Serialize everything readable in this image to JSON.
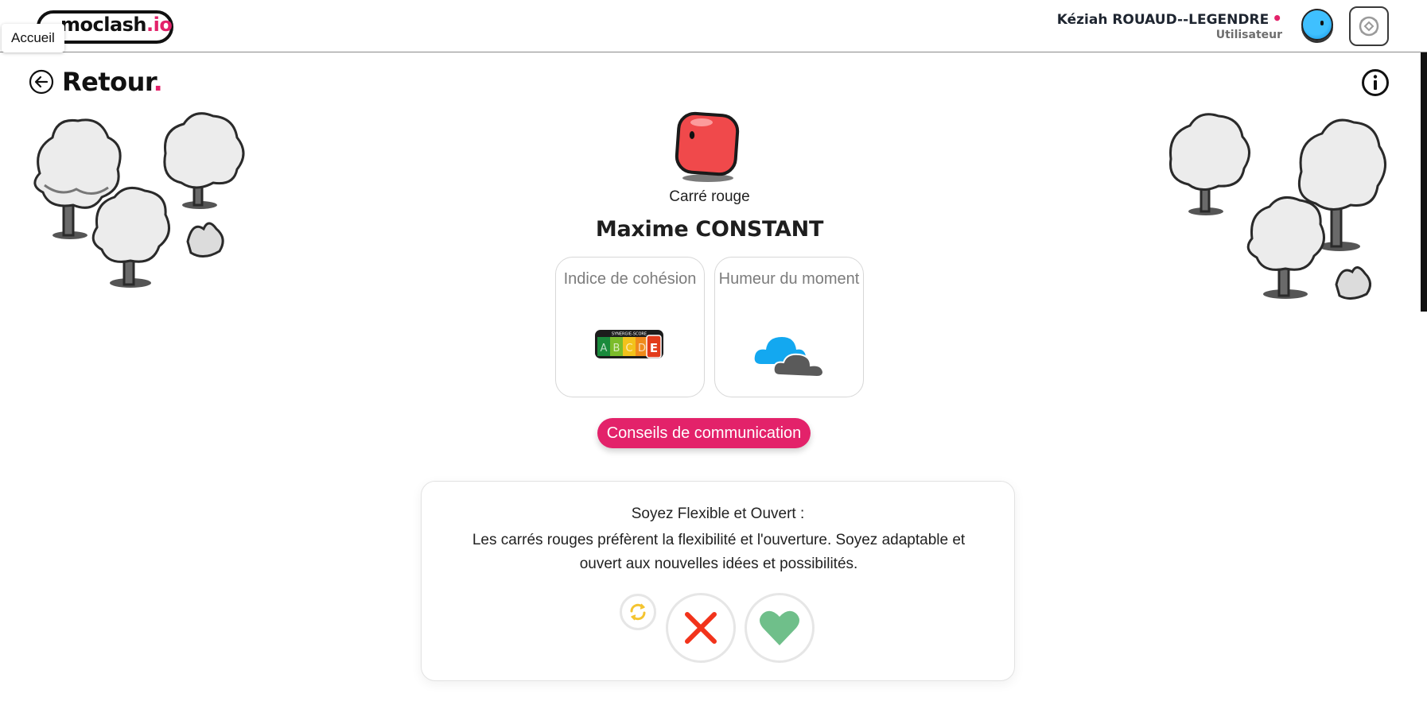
{
  "header": {
    "logo_text": "moclash",
    "logo_suffix": ".io",
    "tooltip": "Accueil",
    "user_name": "Kéziah ROUAUD--LEGENDRE",
    "user_role": "Utilisateur"
  },
  "nav": {
    "back_label": "Retour"
  },
  "profile": {
    "character_type": "Carré rouge",
    "person_name": "Maxime CONSTANT"
  },
  "cards": {
    "cohesion_title": "Indice de cohésion",
    "cohesion_badge_header": "SYNERGIE-SCORE",
    "cohesion_grades": [
      "A",
      "B",
      "C",
      "D",
      "E"
    ],
    "cohesion_active_grade": "E",
    "mood_title": "Humeur du moment"
  },
  "advice": {
    "button_label": "Conseils de communication",
    "title": "Soyez Flexible et Ouvert :",
    "text": "Les carrés rouges préfèrent la flexibilité et l'ouverture. Soyez adaptable et ouvert aux nouvelles idées et possibilités."
  },
  "colors": {
    "accent": "#e3226a",
    "character": "#f0494b",
    "avatar": "#1ea8f0",
    "reject": "#f2331b",
    "like": "#6fbf8a",
    "refresh": "#f4c430"
  },
  "icons": {
    "back": "arrow-left-circle-icon",
    "info": "info-icon",
    "settings": "settings-icon",
    "reject": "close-icon",
    "like": "heart-icon",
    "refresh": "refresh-icon",
    "mood": "cloud-icon"
  }
}
